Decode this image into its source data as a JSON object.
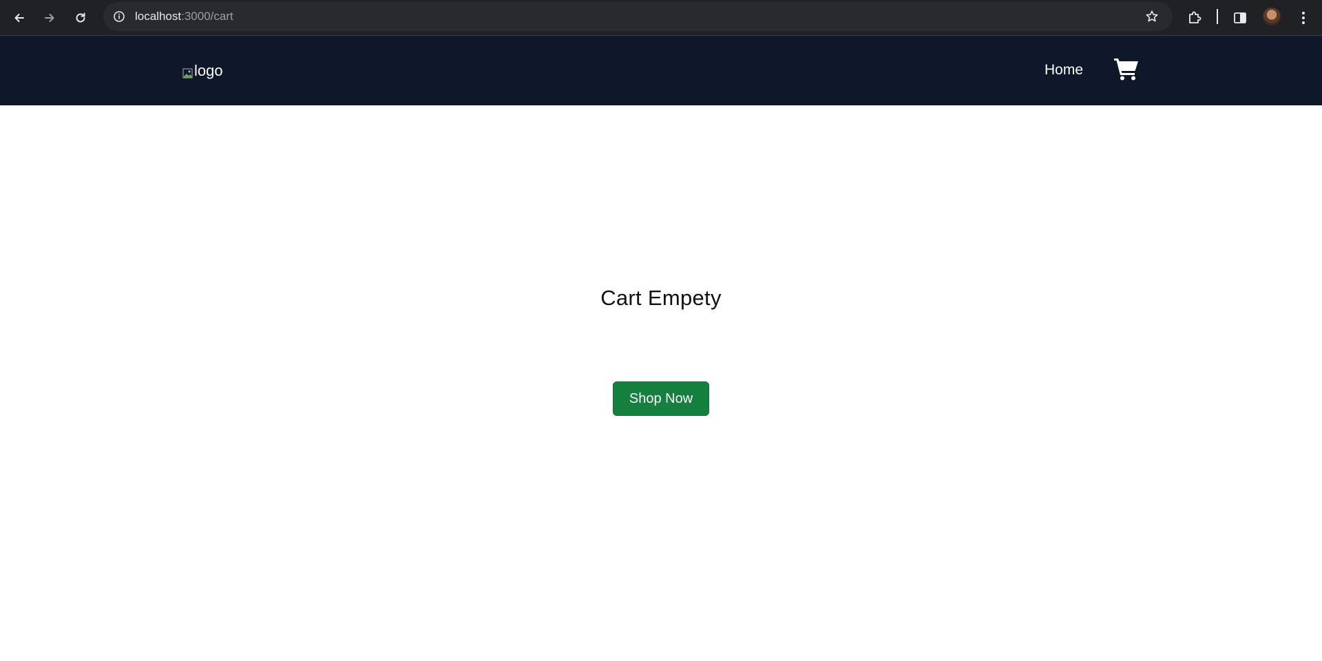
{
  "browser": {
    "url_host": "localhost",
    "url_path": ":3000/cart",
    "icons": [
      "back-arrow-icon",
      "forward-arrow-icon",
      "reload-icon",
      "site-info-icon",
      "star-icon",
      "extensions-icon",
      "side-panel-icon",
      "profile-avatar",
      "more-menu-icon"
    ]
  },
  "header": {
    "logo_alt": "logo",
    "nav_home": "Home",
    "cart_icon": "shopping-cart-icon"
  },
  "main": {
    "empty_message": "Cart Empety",
    "shop_button": "Shop Now"
  },
  "colors": {
    "header_bg": "#0f172a",
    "button_bg": "#15803d",
    "chrome_bg": "#202124"
  }
}
